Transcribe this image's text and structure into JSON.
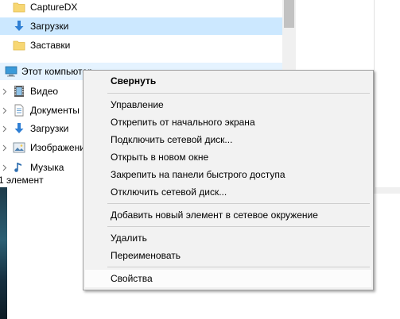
{
  "nav": {
    "items": [
      {
        "label": "CaptureDX",
        "icon": "folder-icon"
      },
      {
        "label": "Загрузки",
        "icon": "download-icon"
      },
      {
        "label": "Заставки",
        "icon": "folder-icon"
      },
      {
        "label": "Этот компьютер",
        "icon": "computer-icon"
      },
      {
        "label": "Видео",
        "icon": "video-icon"
      },
      {
        "label": "Документы",
        "icon": "documents-icon"
      },
      {
        "label": "Загрузки",
        "icon": "download-icon"
      },
      {
        "label": "Изображения",
        "icon": "pictures-icon"
      },
      {
        "label": "Музыка",
        "icon": "music-icon"
      }
    ]
  },
  "status": {
    "text": "1 элемент"
  },
  "context_menu": {
    "items": [
      "Свернуть",
      "Управление",
      "Открепить от начального экрана",
      "Подключить сетевой диск...",
      "Открыть в новом окне",
      "Закрепить на панели быстрого доступа",
      "Отключить сетевой диск...",
      "Добавить новый элемент в сетевое окружение",
      "Удалить",
      "Переименовать",
      "Свойства"
    ]
  },
  "colors": {
    "selection": "#cce8ff",
    "menu_background": "#f2f2f2",
    "folder": "#f7d774",
    "download_arrow": "#2f7fd4"
  }
}
